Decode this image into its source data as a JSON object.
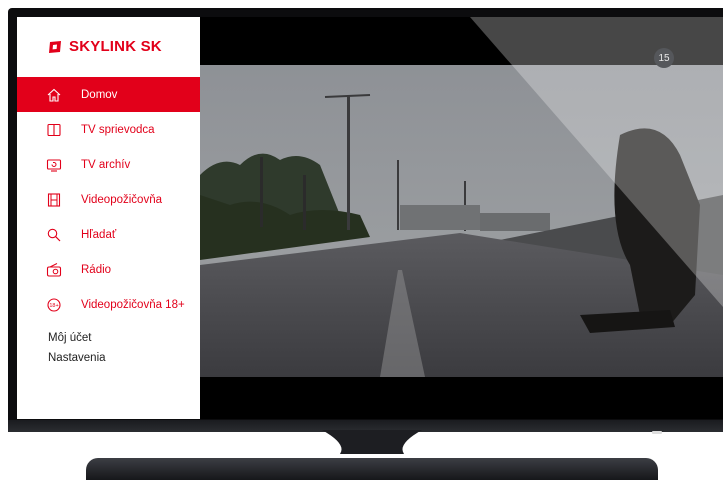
{
  "brand": {
    "name": "SKYLINK SK",
    "color": "#e2001a"
  },
  "menu": {
    "items": [
      {
        "label": "Domov",
        "icon": "home-icon",
        "active": true
      },
      {
        "label": "TV sprievodca",
        "icon": "book-icon",
        "active": false
      },
      {
        "label": "TV archív",
        "icon": "tv-replay-icon",
        "active": false
      },
      {
        "label": "Videopožičovňa",
        "icon": "film-icon",
        "active": false
      },
      {
        "label": "Hľadať",
        "icon": "search-icon",
        "active": false
      },
      {
        "label": "Rádio",
        "icon": "radio-icon",
        "active": false
      },
      {
        "label": "Videopožičovňa 18+",
        "icon": "adult-18-icon",
        "active": false
      }
    ]
  },
  "account": {
    "label": "Môj účet"
  },
  "settings": {
    "label": "Nastavenia"
  },
  "player": {
    "age_rating": "15"
  },
  "colors": {
    "accent": "#e2001a",
    "sidebar_bg": "#ffffff",
    "text_dark": "#222222"
  }
}
